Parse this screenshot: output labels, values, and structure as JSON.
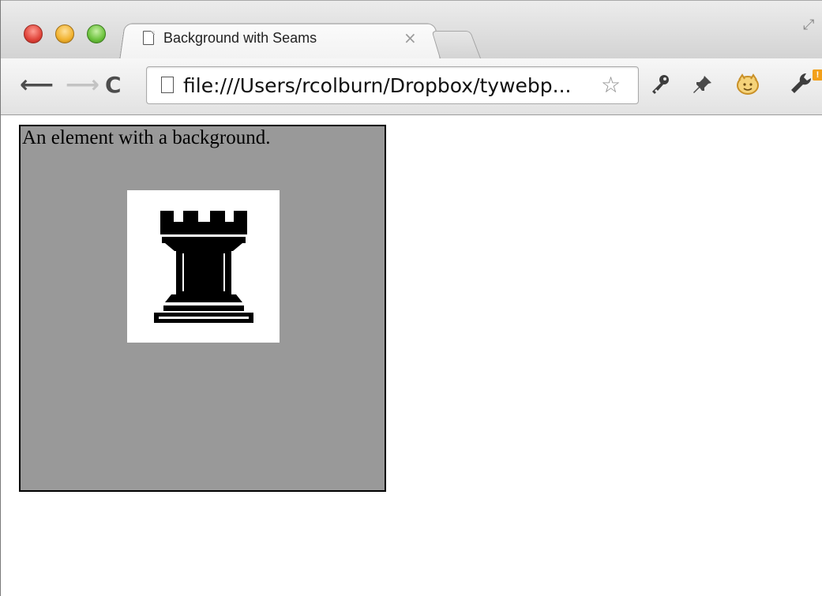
{
  "browser": {
    "tab": {
      "title": "Background with Seams",
      "close_glyph": "×"
    },
    "toolbar": {
      "back_glyph": "⟵",
      "forward_glyph": "⟶",
      "reload_glyph": "C",
      "url": "file:///Users/rcolburn/Dropbox/tywebp...",
      "star_glyph": "☆",
      "extensions": [
        "key-icon",
        "pushpin-icon",
        "smiley-extension-icon",
        "wrench-menu-icon"
      ]
    }
  },
  "page": {
    "element_text": "An element with a background.",
    "element_background_color": "#999999",
    "tile_background_color": "#ffffff",
    "tile_icon": "chess-rook-icon"
  }
}
